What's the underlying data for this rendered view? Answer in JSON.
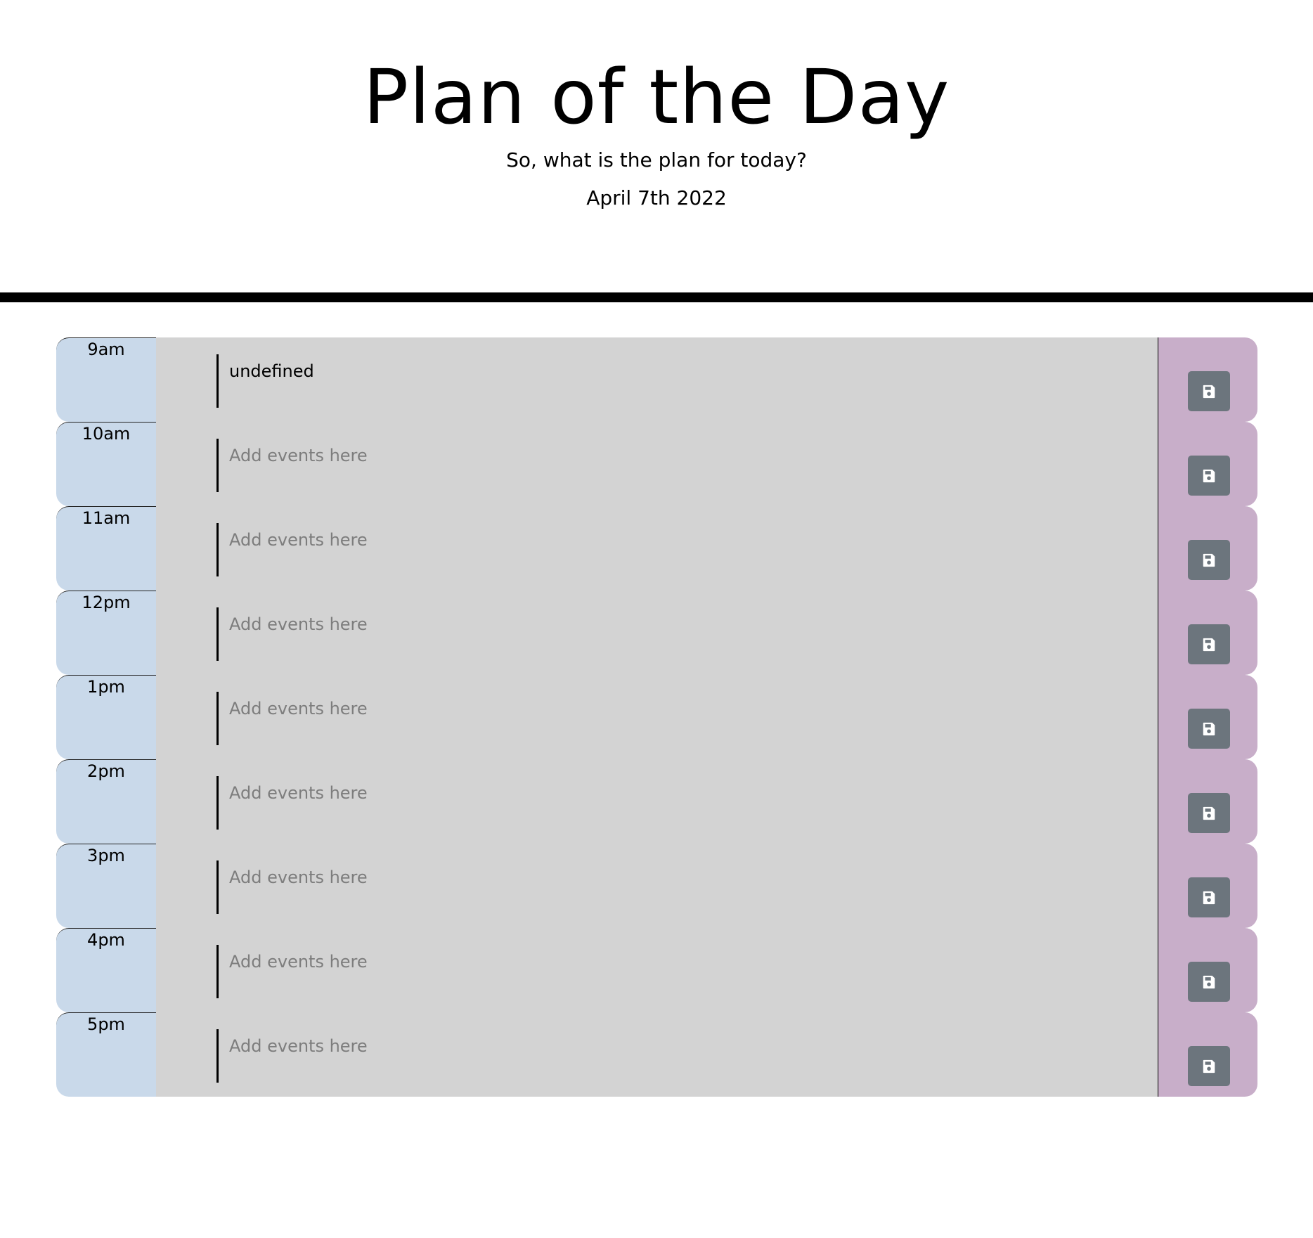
{
  "header": {
    "title": "Plan of the Day",
    "subtitle": "So, what is the plan for today?",
    "date": "April 7th 2022"
  },
  "colors": {
    "past_hour": "#c9d9ea",
    "event_area": "#d3d3d3",
    "save_column": "#c8aec9",
    "save_button": "#6c757d"
  },
  "save_icon": "floppy-disk-icon",
  "timeblocks": [
    {
      "hour": "9am",
      "value": "undefined",
      "placeholder": "Add events here"
    },
    {
      "hour": "10am",
      "value": "",
      "placeholder": "Add events here"
    },
    {
      "hour": "11am",
      "value": "",
      "placeholder": "Add events here"
    },
    {
      "hour": "12pm",
      "value": "",
      "placeholder": "Add events here"
    },
    {
      "hour": "1pm",
      "value": "",
      "placeholder": "Add events here"
    },
    {
      "hour": "2pm",
      "value": "",
      "placeholder": "Add events here"
    },
    {
      "hour": "3pm",
      "value": "",
      "placeholder": "Add events here"
    },
    {
      "hour": "4pm",
      "value": "",
      "placeholder": "Add events here"
    },
    {
      "hour": "5pm",
      "value": "",
      "placeholder": "Add events here"
    }
  ]
}
